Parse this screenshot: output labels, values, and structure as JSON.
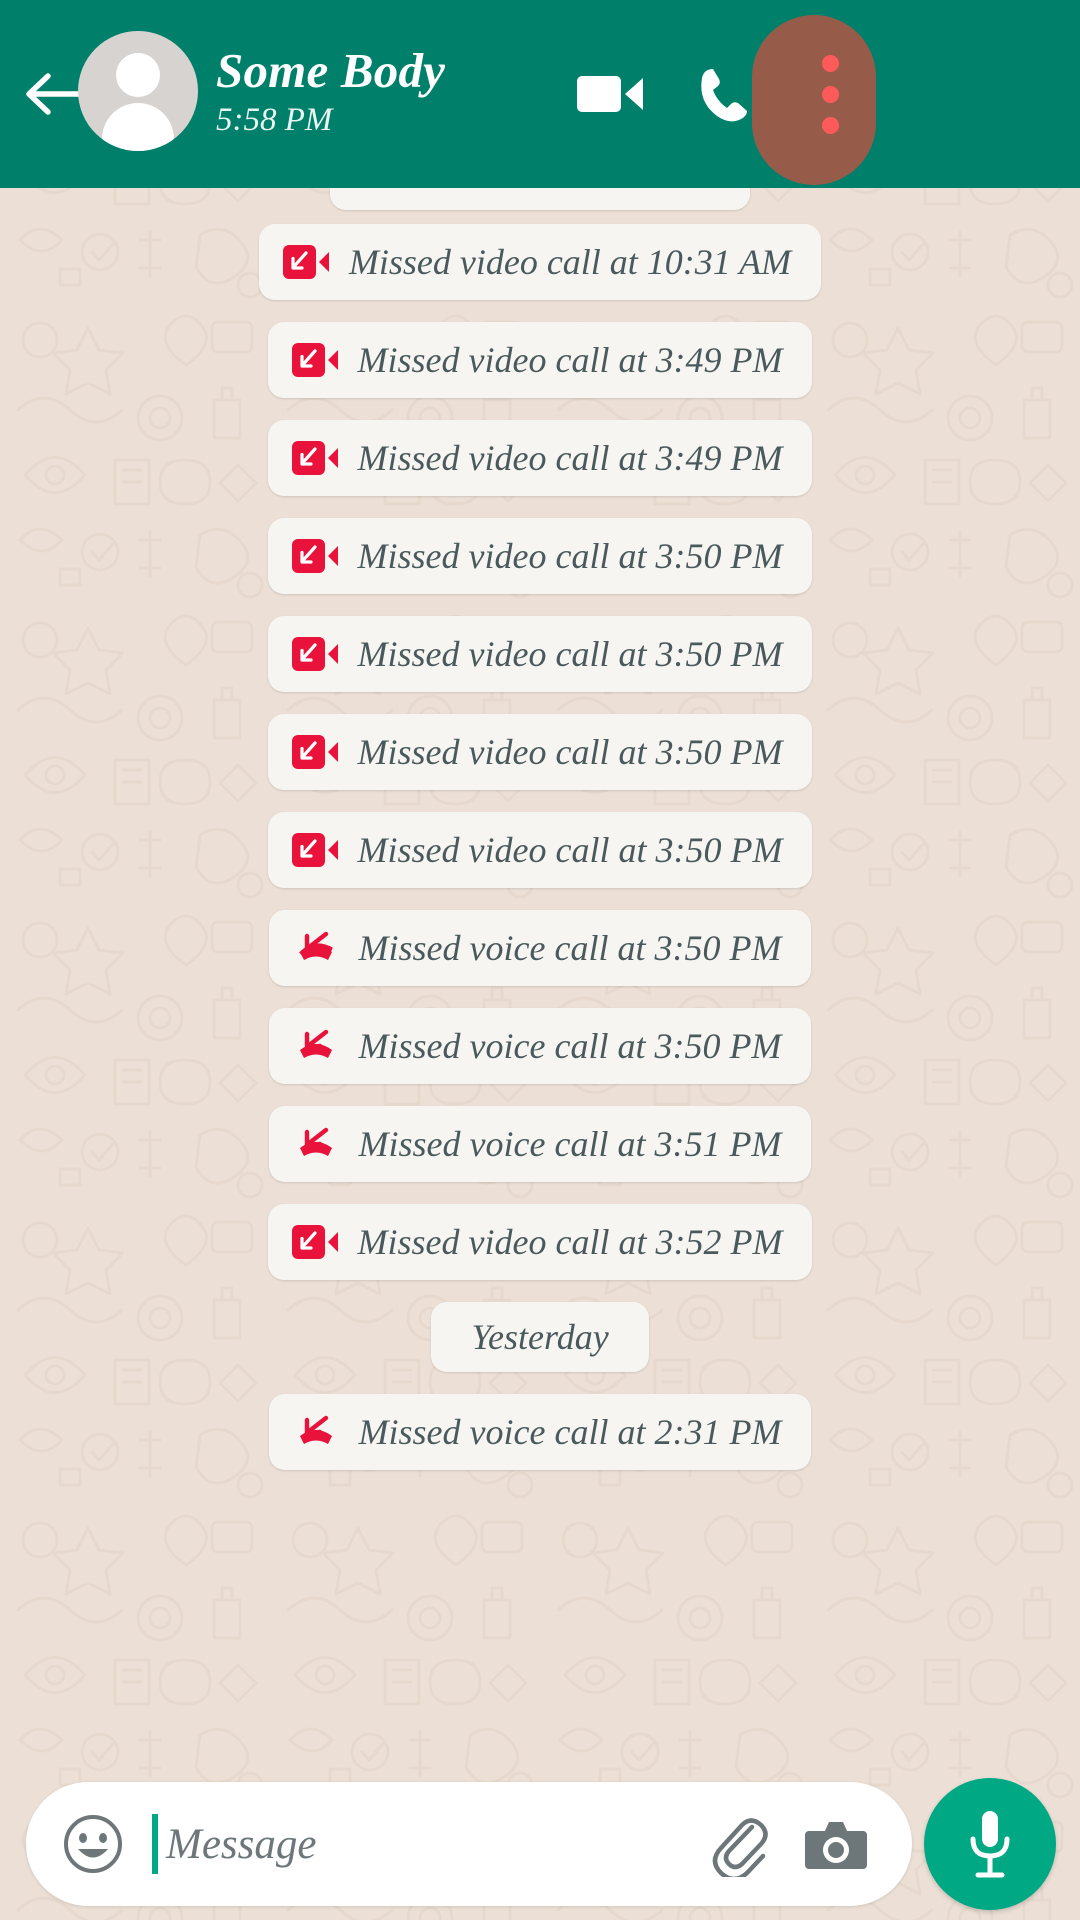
{
  "header": {
    "back_icon": "arrow-left-icon",
    "avatar_icon": "default-person-avatar",
    "contact_name": "Some Body",
    "status_text": "5:58 PM",
    "video_call_icon": "video-camera-icon",
    "voice_call_icon": "phone-icon",
    "overflow_icon": "three-dot-menu-icon",
    "colors": {
      "bar": "#00806a",
      "title": "#ffffff",
      "status": "#e9f5f1",
      "ripple": "#f4665f"
    }
  },
  "chat": {
    "background_color": "#ece0d6",
    "bubble_color": "#f7f5f2",
    "text_color": "#4a5a5c",
    "missed_call_icon_color": "#e8123b",
    "messages": [
      {
        "type": "clipped",
        "icon": "",
        "label": ""
      },
      {
        "type": "video",
        "icon": "missed-video-call-icon",
        "label": "Missed video call at 10:31 AM"
      },
      {
        "type": "video",
        "icon": "missed-video-call-icon",
        "label": "Missed video call at 3:49 PM"
      },
      {
        "type": "video",
        "icon": "missed-video-call-icon",
        "label": "Missed video call at 3:49 PM"
      },
      {
        "type": "video",
        "icon": "missed-video-call-icon",
        "label": "Missed video call at 3:50 PM"
      },
      {
        "type": "video",
        "icon": "missed-video-call-icon",
        "label": "Missed video call at 3:50 PM"
      },
      {
        "type": "video",
        "icon": "missed-video-call-icon",
        "label": "Missed video call at 3:50 PM"
      },
      {
        "type": "video",
        "icon": "missed-video-call-icon",
        "label": "Missed video call at 3:50 PM"
      },
      {
        "type": "voice",
        "icon": "missed-voice-call-icon",
        "label": "Missed voice call at 3:50 PM"
      },
      {
        "type": "voice",
        "icon": "missed-voice-call-icon",
        "label": "Missed voice call at 3:50 PM"
      },
      {
        "type": "voice",
        "icon": "missed-voice-call-icon",
        "label": "Missed voice call at 3:51 PM"
      },
      {
        "type": "video",
        "icon": "missed-video-call-icon",
        "label": "Missed video call at 3:52 PM"
      },
      {
        "type": "date",
        "icon": "",
        "label": "Yesterday"
      },
      {
        "type": "voice",
        "icon": "missed-voice-call-icon",
        "label": "Missed voice call at 2:31 PM"
      }
    ]
  },
  "input_bar": {
    "emoji_icon": "smiley-face-icon",
    "placeholder": "Message",
    "value": "",
    "attach_icon": "paperclip-icon",
    "camera_icon": "camera-icon",
    "mic_icon": "microphone-icon",
    "send_button_color": "#00a884",
    "caret_color": "#00a884"
  }
}
